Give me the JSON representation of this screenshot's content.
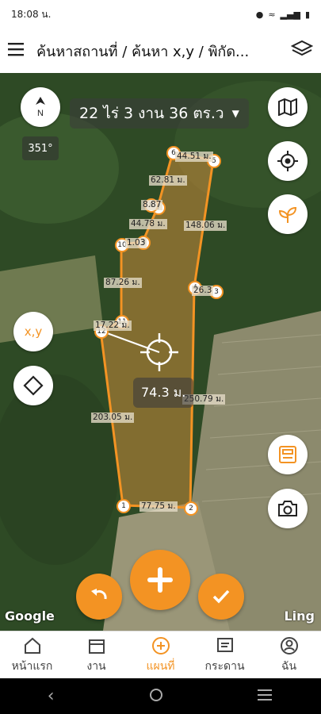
{
  "status_bar": {
    "time": "18:08 น."
  },
  "app_bar": {
    "title": "ค้นหาสถานที่ / ค้นหา x,y / พิกัด..."
  },
  "map": {
    "area_text": "22 ไร่ 3 งาน 36 ตร.ว",
    "bearing": "351°",
    "xy_button_label": "x,y",
    "current_distance": "74.3 ม.",
    "distance_labels": [
      "44.51 ม.",
      "62.81 ม.",
      "8.87",
      "44.78 ม.",
      "148.06 ม.",
      "1.03",
      "26.3",
      "87.26 ม.",
      "17.22 ม.",
      "250.79 ม.",
      "203.05 ม.",
      "77.75 ม."
    ],
    "vertex_labels": [
      "1",
      "2",
      "3",
      "4",
      "5",
      "6",
      "7",
      "8",
      "9",
      "10",
      "11",
      "12"
    ],
    "attribution_left": "Google",
    "attribution_right": "Ling"
  },
  "colors": {
    "accent": "#f39323",
    "polygon_fill": "#c98a3a"
  },
  "bottom_nav": [
    {
      "label": "หน้าแรก",
      "icon": "home-icon",
      "active": false
    },
    {
      "label": "งาน",
      "icon": "calendar-icon",
      "active": false
    },
    {
      "label": "แผนที่",
      "icon": "add-circle-icon",
      "active": true
    },
    {
      "label": "กระดาน",
      "icon": "board-icon",
      "active": false
    },
    {
      "label": "ฉัน",
      "icon": "user-icon",
      "active": false
    }
  ]
}
